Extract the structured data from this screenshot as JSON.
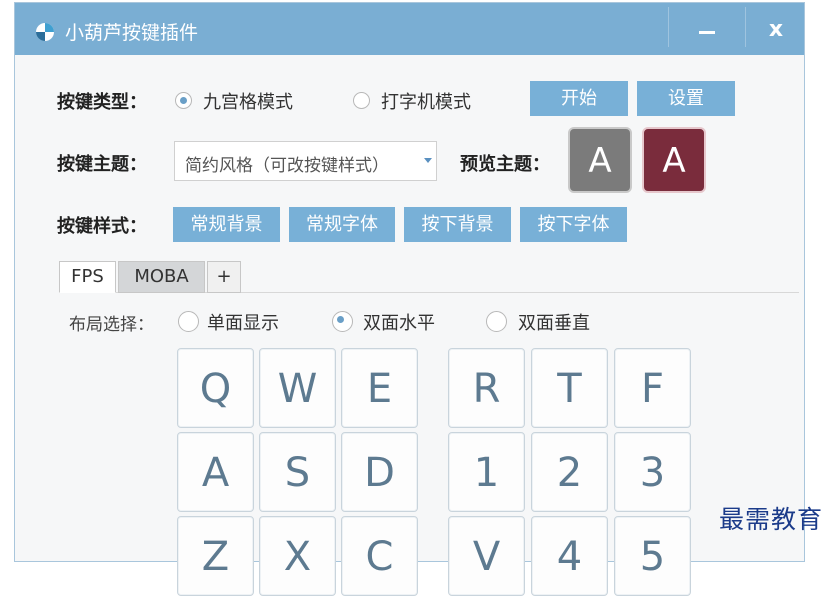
{
  "window": {
    "title": "小葫芦按键插件",
    "close_label": "x"
  },
  "key_type": {
    "label": "按键类型：",
    "options": [
      "九宫格模式",
      "打字机模式"
    ],
    "selected": "九宫格模式",
    "start_button": "开始",
    "settings_button": "设置"
  },
  "key_theme": {
    "label": "按键主题：",
    "selected": "简约风格（可改按键样式）",
    "preview_label": "预览主题：",
    "preview_letters": [
      "A",
      "A"
    ],
    "preview_colors": [
      "#7b7b7b",
      "#7a2c3c"
    ]
  },
  "key_style": {
    "label": "按键样式：",
    "buttons": [
      "常规背景",
      "常规字体",
      "按下背景",
      "按下字体"
    ]
  },
  "tabs": [
    "FPS",
    "MOBA",
    "+"
  ],
  "active_tab": "FPS",
  "layout": {
    "label": "布局选择：",
    "options": [
      "单面显示",
      "双面水平",
      "双面垂直"
    ],
    "selected": "双面水平"
  },
  "keys_left": [
    [
      "Q",
      "W",
      "E"
    ],
    [
      "A",
      "S",
      "D"
    ],
    [
      "Z",
      "X",
      "C"
    ]
  ],
  "keys_right": [
    [
      "R",
      "T",
      "F"
    ],
    [
      "1",
      "2",
      "3"
    ],
    [
      "V",
      "4",
      "5"
    ]
  ],
  "watermark": "最需教育",
  "colors": {
    "titlebar": "#7aaed3",
    "button": "#78b0d7",
    "key_text": "#5d7a90"
  }
}
